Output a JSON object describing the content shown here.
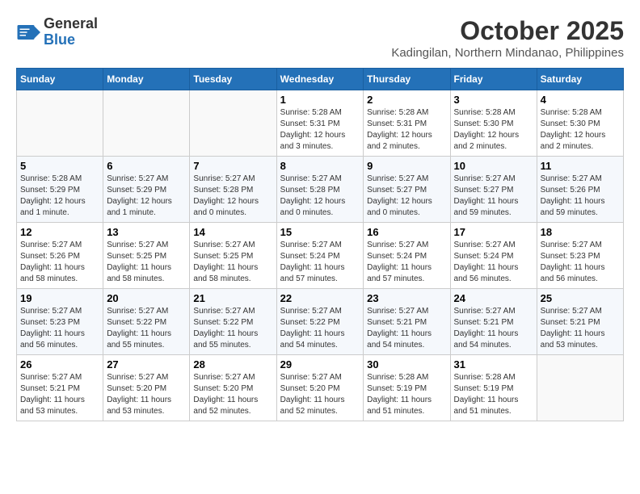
{
  "header": {
    "logo_line1": "General",
    "logo_line2": "Blue",
    "month_title": "October 2025",
    "subtitle": "Kadingilan, Northern Mindanao, Philippines"
  },
  "weekdays": [
    "Sunday",
    "Monday",
    "Tuesday",
    "Wednesday",
    "Thursday",
    "Friday",
    "Saturday"
  ],
  "weeks": [
    [
      {
        "day": "",
        "info": ""
      },
      {
        "day": "",
        "info": ""
      },
      {
        "day": "",
        "info": ""
      },
      {
        "day": "1",
        "info": "Sunrise: 5:28 AM\nSunset: 5:31 PM\nDaylight: 12 hours and 3 minutes."
      },
      {
        "day": "2",
        "info": "Sunrise: 5:28 AM\nSunset: 5:31 PM\nDaylight: 12 hours and 2 minutes."
      },
      {
        "day": "3",
        "info": "Sunrise: 5:28 AM\nSunset: 5:30 PM\nDaylight: 12 hours and 2 minutes."
      },
      {
        "day": "4",
        "info": "Sunrise: 5:28 AM\nSunset: 5:30 PM\nDaylight: 12 hours and 2 minutes."
      }
    ],
    [
      {
        "day": "5",
        "info": "Sunrise: 5:28 AM\nSunset: 5:29 PM\nDaylight: 12 hours and 1 minute."
      },
      {
        "day": "6",
        "info": "Sunrise: 5:27 AM\nSunset: 5:29 PM\nDaylight: 12 hours and 1 minute."
      },
      {
        "day": "7",
        "info": "Sunrise: 5:27 AM\nSunset: 5:28 PM\nDaylight: 12 hours and 0 minutes."
      },
      {
        "day": "8",
        "info": "Sunrise: 5:27 AM\nSunset: 5:28 PM\nDaylight: 12 hours and 0 minutes."
      },
      {
        "day": "9",
        "info": "Sunrise: 5:27 AM\nSunset: 5:27 PM\nDaylight: 12 hours and 0 minutes."
      },
      {
        "day": "10",
        "info": "Sunrise: 5:27 AM\nSunset: 5:27 PM\nDaylight: 11 hours and 59 minutes."
      },
      {
        "day": "11",
        "info": "Sunrise: 5:27 AM\nSunset: 5:26 PM\nDaylight: 11 hours and 59 minutes."
      }
    ],
    [
      {
        "day": "12",
        "info": "Sunrise: 5:27 AM\nSunset: 5:26 PM\nDaylight: 11 hours and 58 minutes."
      },
      {
        "day": "13",
        "info": "Sunrise: 5:27 AM\nSunset: 5:25 PM\nDaylight: 11 hours and 58 minutes."
      },
      {
        "day": "14",
        "info": "Sunrise: 5:27 AM\nSunset: 5:25 PM\nDaylight: 11 hours and 58 minutes."
      },
      {
        "day": "15",
        "info": "Sunrise: 5:27 AM\nSunset: 5:24 PM\nDaylight: 11 hours and 57 minutes."
      },
      {
        "day": "16",
        "info": "Sunrise: 5:27 AM\nSunset: 5:24 PM\nDaylight: 11 hours and 57 minutes."
      },
      {
        "day": "17",
        "info": "Sunrise: 5:27 AM\nSunset: 5:24 PM\nDaylight: 11 hours and 56 minutes."
      },
      {
        "day": "18",
        "info": "Sunrise: 5:27 AM\nSunset: 5:23 PM\nDaylight: 11 hours and 56 minutes."
      }
    ],
    [
      {
        "day": "19",
        "info": "Sunrise: 5:27 AM\nSunset: 5:23 PM\nDaylight: 11 hours and 56 minutes."
      },
      {
        "day": "20",
        "info": "Sunrise: 5:27 AM\nSunset: 5:22 PM\nDaylight: 11 hours and 55 minutes."
      },
      {
        "day": "21",
        "info": "Sunrise: 5:27 AM\nSunset: 5:22 PM\nDaylight: 11 hours and 55 minutes."
      },
      {
        "day": "22",
        "info": "Sunrise: 5:27 AM\nSunset: 5:22 PM\nDaylight: 11 hours and 54 minutes."
      },
      {
        "day": "23",
        "info": "Sunrise: 5:27 AM\nSunset: 5:21 PM\nDaylight: 11 hours and 54 minutes."
      },
      {
        "day": "24",
        "info": "Sunrise: 5:27 AM\nSunset: 5:21 PM\nDaylight: 11 hours and 54 minutes."
      },
      {
        "day": "25",
        "info": "Sunrise: 5:27 AM\nSunset: 5:21 PM\nDaylight: 11 hours and 53 minutes."
      }
    ],
    [
      {
        "day": "26",
        "info": "Sunrise: 5:27 AM\nSunset: 5:21 PM\nDaylight: 11 hours and 53 minutes."
      },
      {
        "day": "27",
        "info": "Sunrise: 5:27 AM\nSunset: 5:20 PM\nDaylight: 11 hours and 53 minutes."
      },
      {
        "day": "28",
        "info": "Sunrise: 5:27 AM\nSunset: 5:20 PM\nDaylight: 11 hours and 52 minutes."
      },
      {
        "day": "29",
        "info": "Sunrise: 5:27 AM\nSunset: 5:20 PM\nDaylight: 11 hours and 52 minutes."
      },
      {
        "day": "30",
        "info": "Sunrise: 5:28 AM\nSunset: 5:19 PM\nDaylight: 11 hours and 51 minutes."
      },
      {
        "day": "31",
        "info": "Sunrise: 5:28 AM\nSunset: 5:19 PM\nDaylight: 11 hours and 51 minutes."
      },
      {
        "day": "",
        "info": ""
      }
    ]
  ]
}
